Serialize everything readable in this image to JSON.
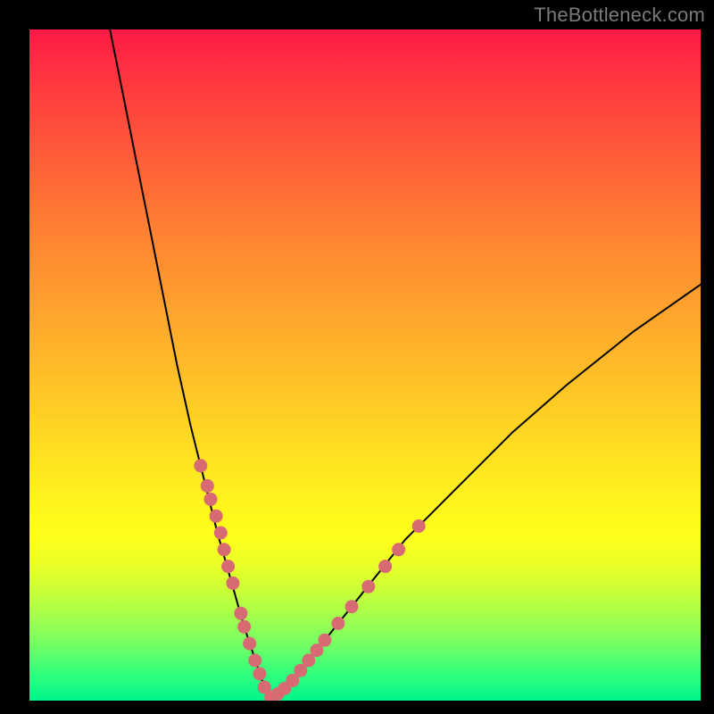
{
  "watermark": "TheBottleneck.com",
  "colors": {
    "marker": "#d86a74",
    "curve": "#000000"
  },
  "chart_data": {
    "type": "line",
    "title": "",
    "xlabel": "",
    "ylabel": "",
    "xlim": [
      0,
      100
    ],
    "ylim": [
      0,
      100
    ],
    "description": "Bottleneck curve over a vertical red-to-green gradient. Curve is a V shape with minimum near x≈35 reaching y≈0; left arm rises steeply to y≈100 at x≈12, right arm rises to y≈62 at x=100. Salmon markers cluster along the lower portion of both arms (roughly y 0–30).",
    "series": [
      {
        "name": "curve",
        "x": [
          12,
          14,
          16,
          18,
          20,
          22,
          24,
          26,
          28,
          30,
          32,
          34,
          35,
          36,
          38,
          40,
          44,
          48,
          52,
          56,
          60,
          66,
          72,
          80,
          90,
          100
        ],
        "y": [
          100,
          90,
          80,
          70,
          60,
          50,
          41,
          33,
          25,
          18,
          11,
          5,
          2,
          0.5,
          1.5,
          4,
          9,
          14,
          19,
          24,
          28,
          34,
          40,
          47,
          55,
          62
        ]
      }
    ],
    "markers": {
      "name": "highlighted-points",
      "x": [
        25.5,
        26.5,
        27.0,
        27.8,
        28.5,
        29.0,
        29.6,
        30.3,
        31.5,
        32.0,
        32.8,
        33.6,
        34.3,
        35.0,
        36.0,
        37.0,
        38.0,
        39.2,
        40.4,
        41.6,
        42.8,
        44.0,
        46.0,
        48.0,
        50.5,
        53.0,
        55.0,
        58.0
      ],
      "y": [
        35,
        32,
        30,
        27.5,
        25,
        22.5,
        20,
        17.5,
        13,
        11,
        8.5,
        6,
        4,
        2,
        0.5,
        1,
        1.8,
        3,
        4.5,
        6,
        7.5,
        9,
        11.5,
        14,
        17,
        20,
        22.5,
        26
      ]
    }
  }
}
